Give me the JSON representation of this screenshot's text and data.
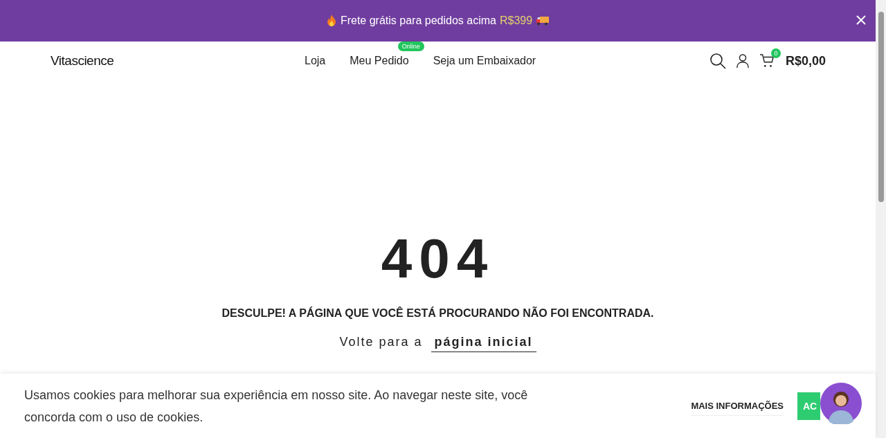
{
  "announcement": {
    "text": "Frete grátis para pedidos acima",
    "highlight": "R$399"
  },
  "header": {
    "logo": "Vitascience",
    "nav": [
      {
        "label": "Loja"
      },
      {
        "label": "Meu Pedido",
        "badge": "Online"
      },
      {
        "label": "Seja um Embaixador"
      }
    ],
    "cart": {
      "count": "0",
      "total": "R$0,00"
    }
  },
  "error": {
    "code": "404",
    "message": "DESCULPE! A PÁGINA QUE VOCÊ ESTÁ PROCURANDO NÃO FOI ENCONTRADA.",
    "back_text": "Volte para a",
    "back_link": "página inicial"
  },
  "cookie_banner": {
    "text": "Usamos cookies para melhorar sua experiência em nosso site. Ao navegar neste site, você concorda com o uso de cookies.",
    "more_button": "MAIS INFORMAÇÕES",
    "accept_button": "AC"
  }
}
